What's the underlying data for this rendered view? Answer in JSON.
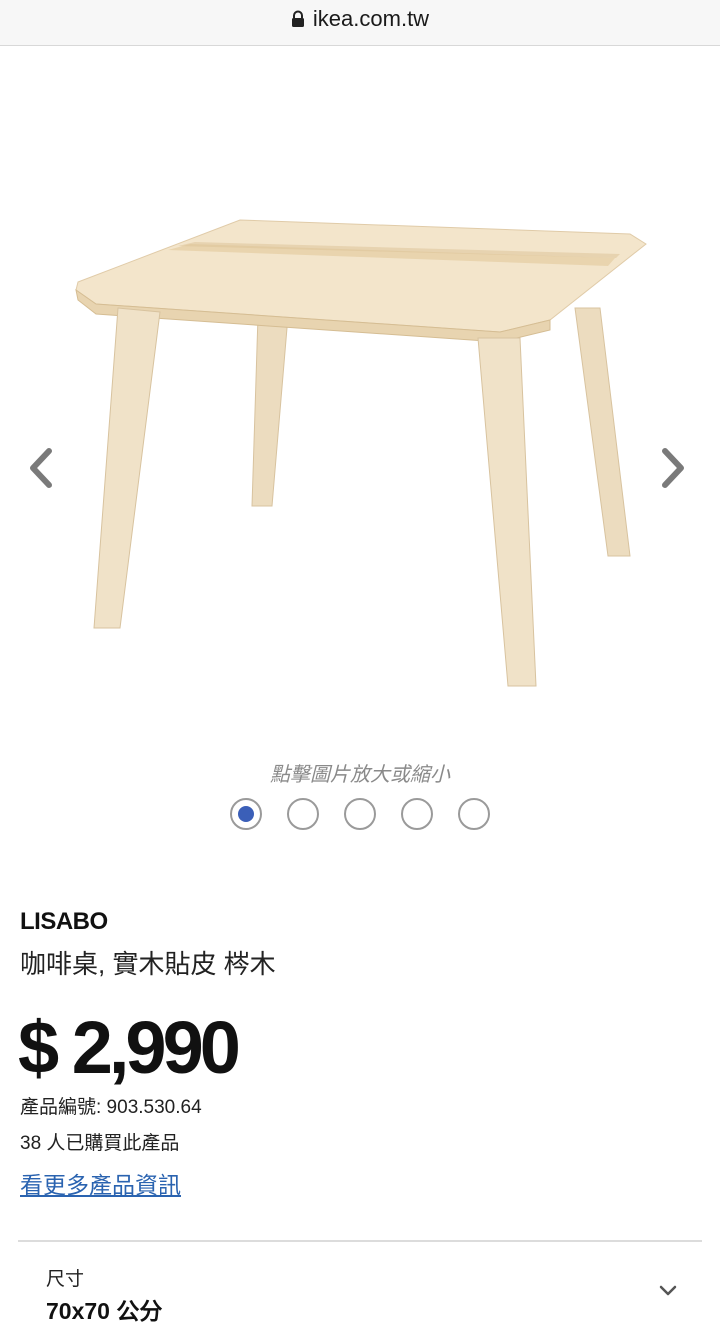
{
  "browser": {
    "url": "ikea.com.tw"
  },
  "gallery": {
    "zoom_hint": "點擊圖片放大或縮小",
    "image_count": 5,
    "active_index": 0
  },
  "product": {
    "brand": "LISABO",
    "description": "咖啡桌, 實木貼皮 梣木",
    "price": "$ 2,990",
    "article_number": "產品編號: 903.530.64",
    "purchase_count": "38 人已購買此產品",
    "more_info_link": "看更多產品資訊"
  },
  "size_selector": {
    "label": "尺寸",
    "value": "70x70 公分"
  },
  "colors": {
    "accent_blue": "#3b5fb8",
    "link_blue": "#2a63b0",
    "wood_light": "#f0e2c8"
  }
}
